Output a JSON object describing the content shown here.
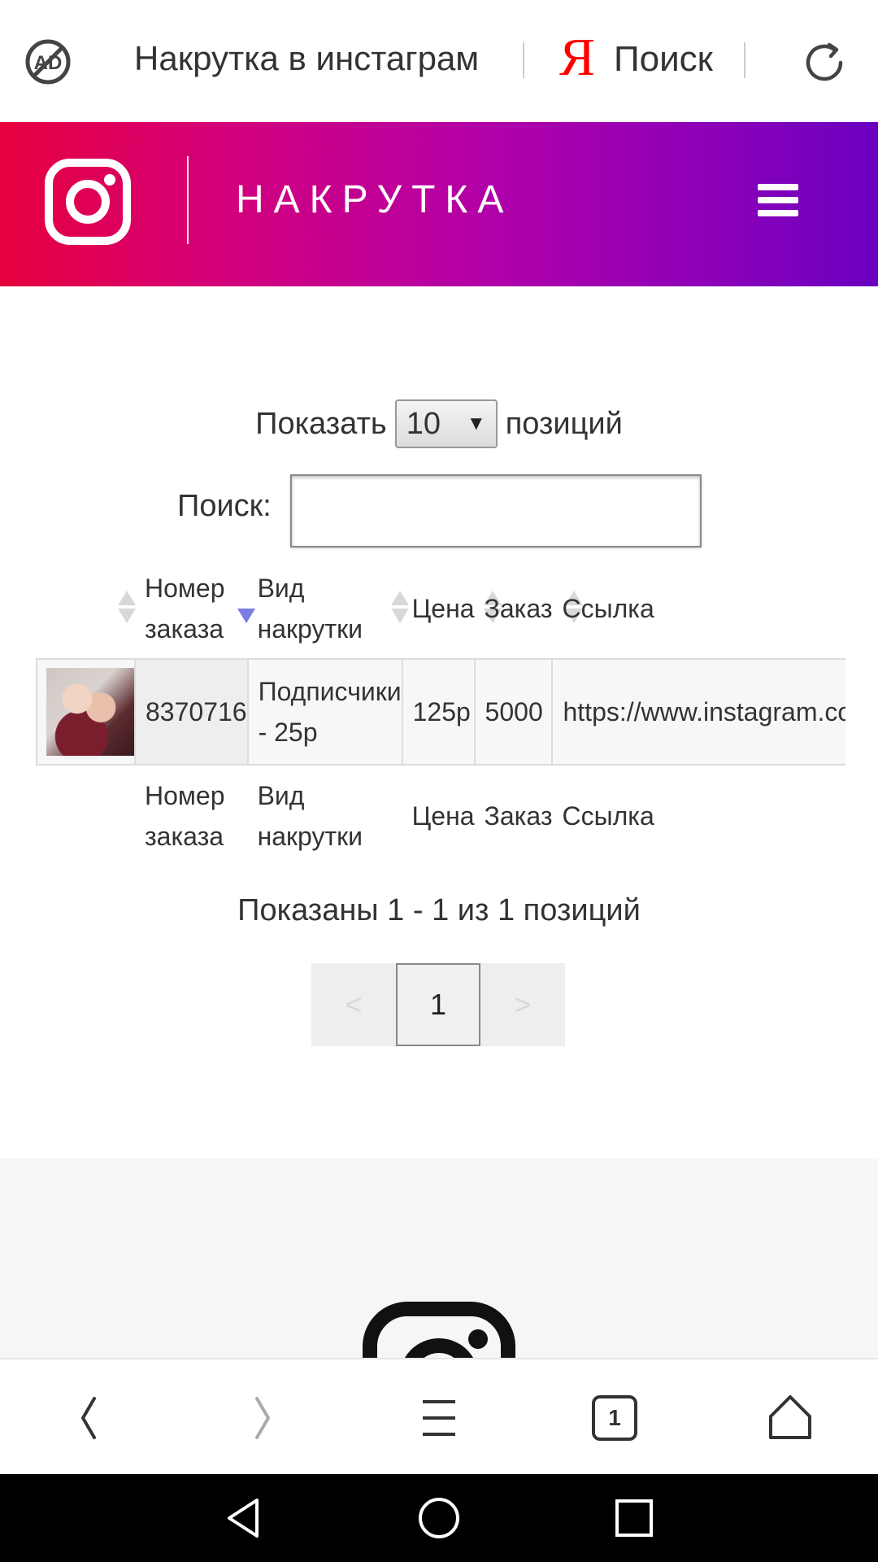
{
  "browser": {
    "tab_title": "Накрутка в инстаграм",
    "yandex_letter": "Я",
    "search_label": "Поиск",
    "tab_count": "1"
  },
  "header": {
    "brand": "НАКРУТКА",
    "gradient_colors": [
      "#e6003d",
      "#b200a8",
      "#6a00c0"
    ]
  },
  "controls": {
    "show_prefix": "Показать",
    "page_size": "10",
    "show_suffix": "позиций",
    "search_label": "Поиск:",
    "search_value": ""
  },
  "table": {
    "columns": [
      "",
      "Номер заказа",
      "Вид накрутки",
      "Цена",
      "Заказ",
      "Ссылка"
    ],
    "rows": [
      {
        "order_number": "8370716",
        "service": "Подписчики - 25р",
        "price": "125р",
        "quantity": "5000",
        "link": "https://www.instagram.com/"
      }
    ]
  },
  "pagination": {
    "info": "Показаны 1 - 1 из 1 позиций",
    "prev": "<",
    "current": "1",
    "next": ">"
  }
}
